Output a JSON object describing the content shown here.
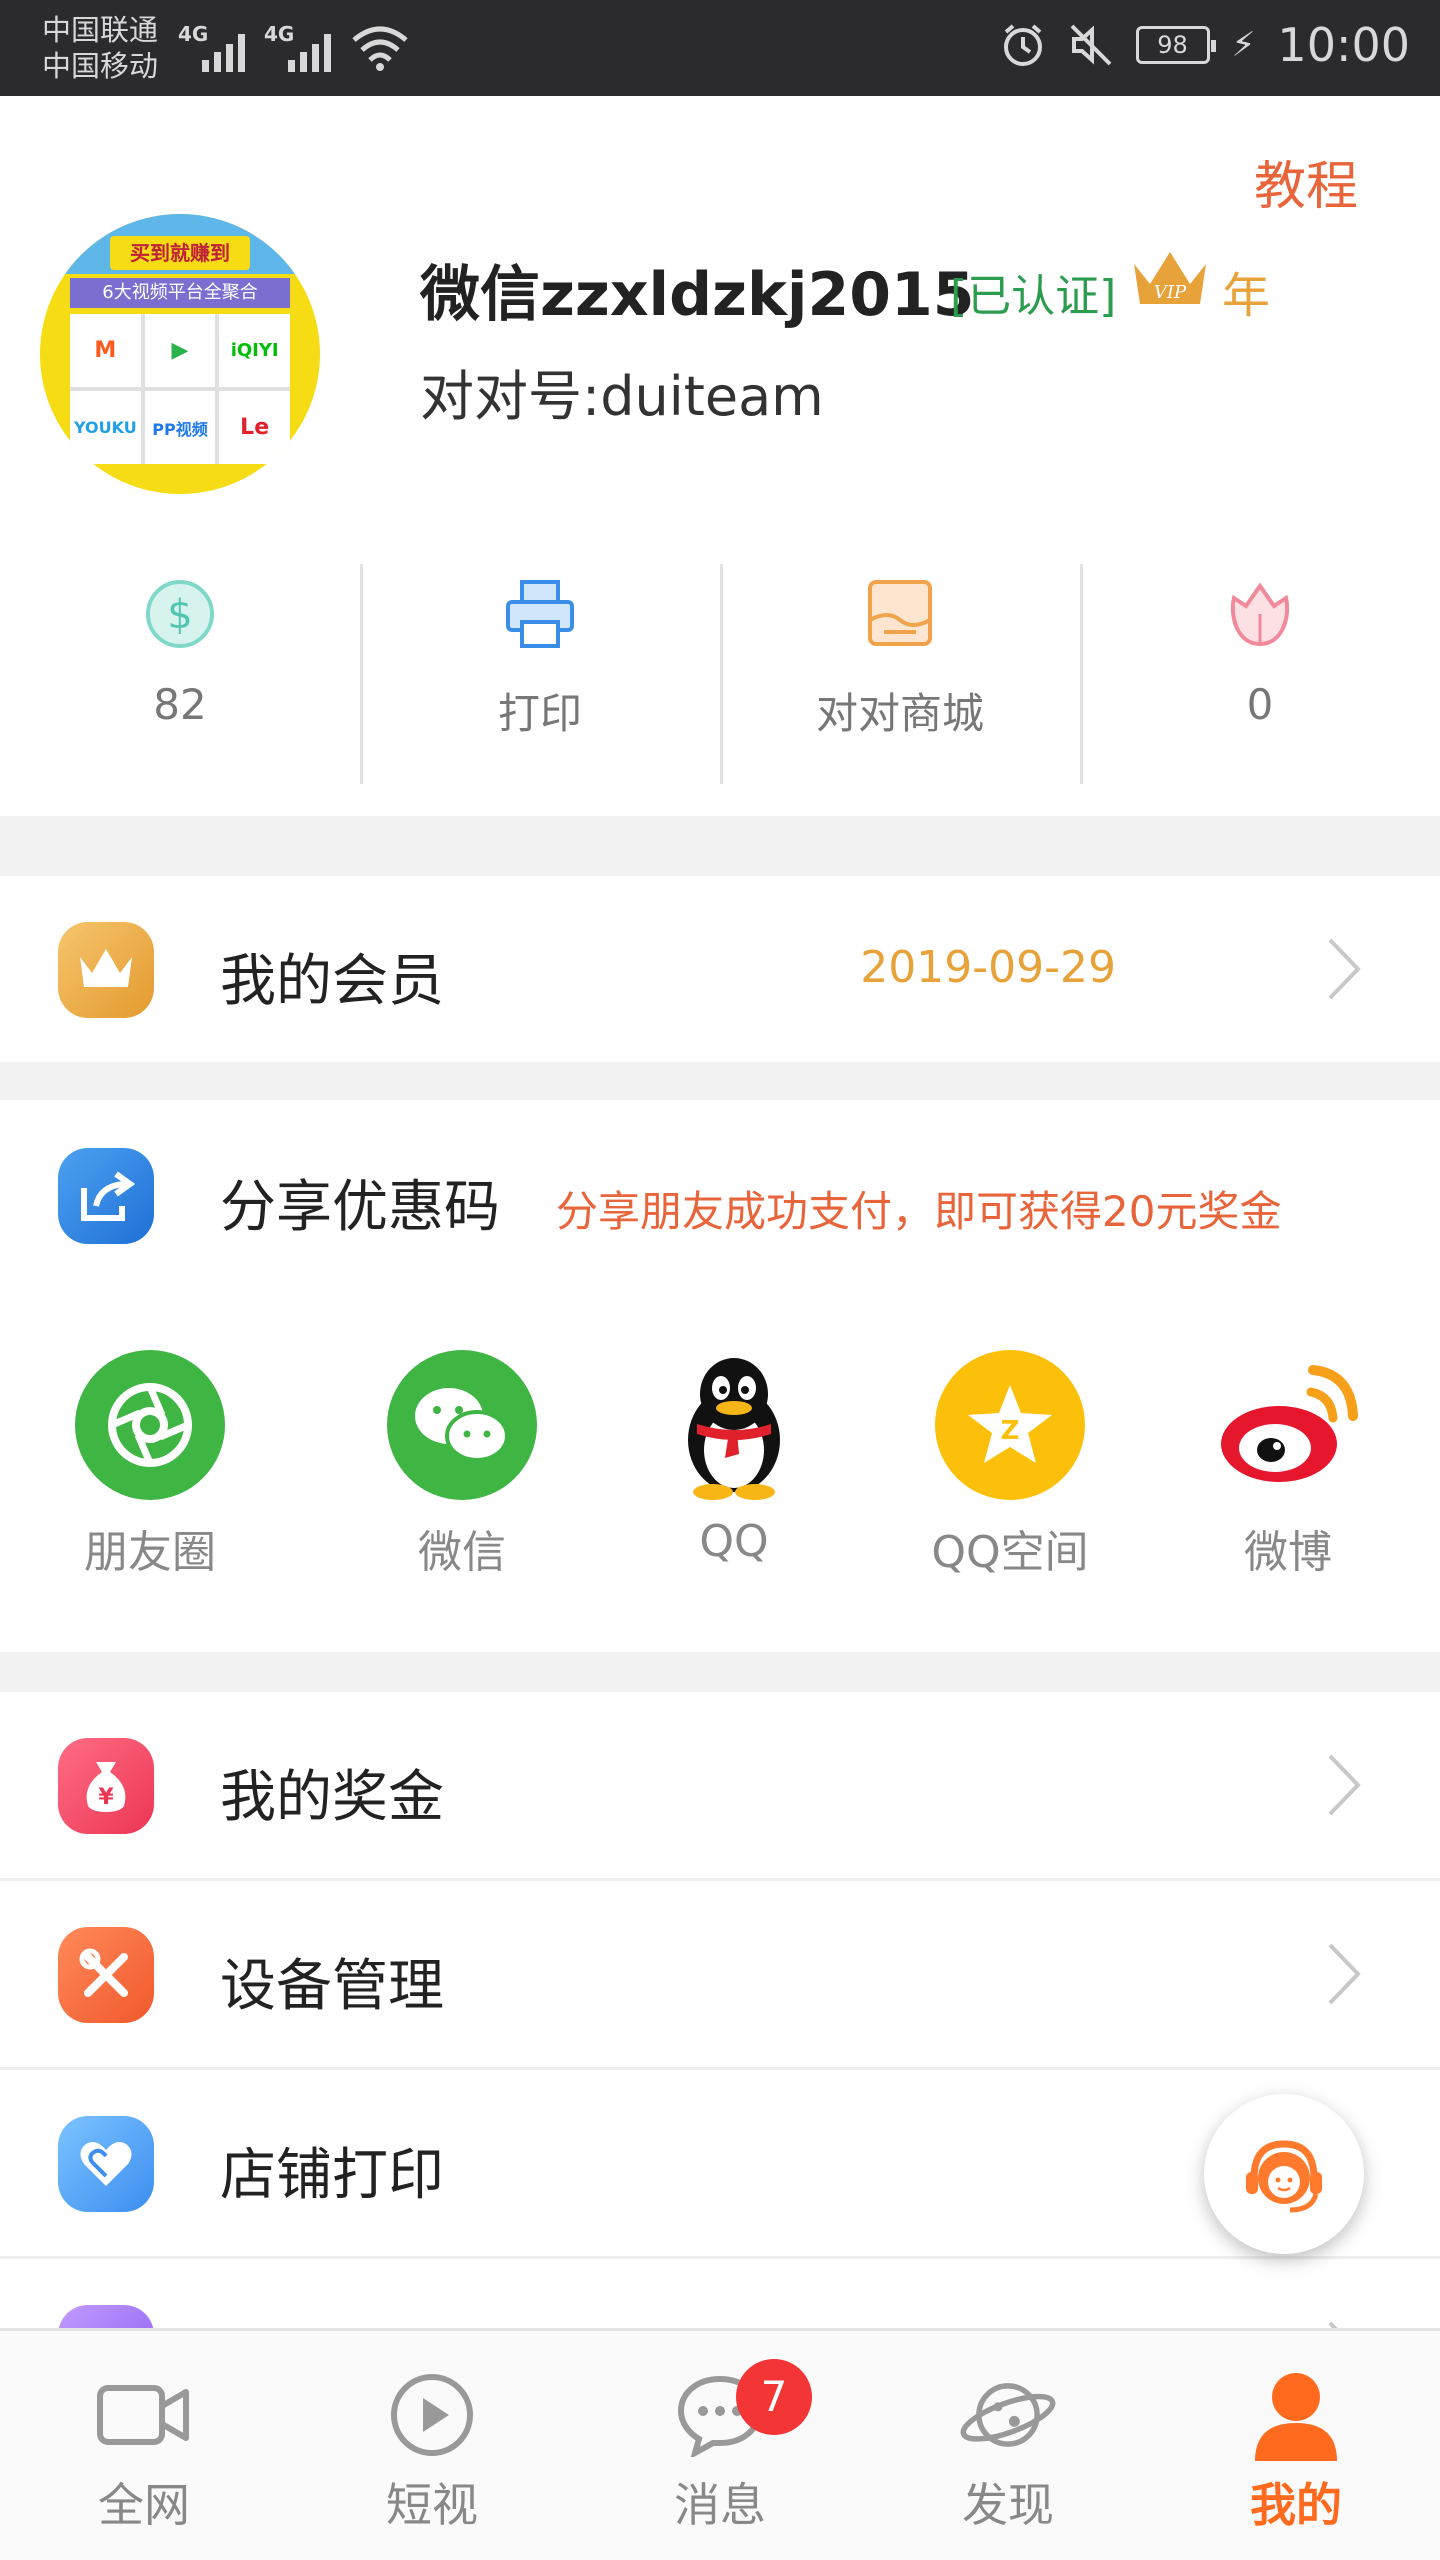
{
  "status_bar": {
    "carrier1": "中国联通",
    "carrier2": "中国移动",
    "net1": "4G",
    "net2": "4G",
    "battery": "98",
    "time": "10:00"
  },
  "profile": {
    "tutorial_label": "教程",
    "avatar_banner": "买到就赚到",
    "avatar_sub": "6大视频平台全聚合",
    "avatar_tiles": [
      "M",
      "▶",
      "iQIYI",
      "YOUKU",
      "PP视频",
      "Le"
    ],
    "name": "微信zzxldzkj2015",
    "verified": "[已认证]",
    "vip_label": "VIP",
    "vip_period": "年",
    "handle": "对对号:duiteam"
  },
  "stats": [
    {
      "icon": "dollar-icon",
      "value": "82"
    },
    {
      "icon": "printer-icon",
      "value": "打印"
    },
    {
      "icon": "mall-icon",
      "value": "对对商城"
    },
    {
      "icon": "flower-icon",
      "value": "0"
    }
  ],
  "membership": {
    "title": "我的会员",
    "date": "2019-09-29"
  },
  "share": {
    "title": "分享优惠码",
    "promo": "分享朋友成功支付，即可获得20元奖金",
    "targets": [
      "朋友圈",
      "微信",
      "QQ",
      "QQ空间",
      "微博"
    ]
  },
  "menu": [
    {
      "title": "我的奖金",
      "icon": "money-bag-icon"
    },
    {
      "title": "设备管理",
      "icon": "tools-icon"
    },
    {
      "title": "店铺打印",
      "icon": "heart-icon"
    }
  ],
  "nav": {
    "tabs": [
      "全网",
      "短视",
      "消息",
      "发现",
      "我的"
    ],
    "message_badge": "7",
    "active": "我的"
  },
  "colors": {
    "accent": "#ff6a1e",
    "promo": "#e8643a",
    "gold": "#e8a23a",
    "verified": "#2c9c4e"
  }
}
